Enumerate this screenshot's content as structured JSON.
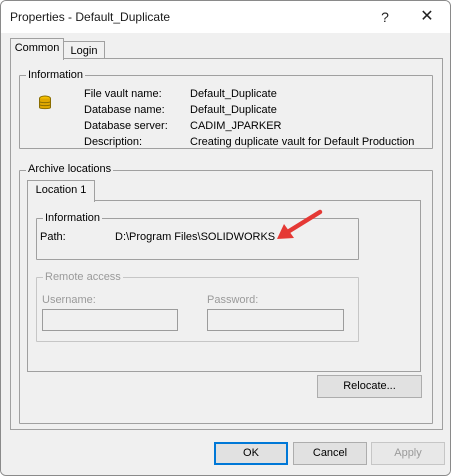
{
  "window": {
    "title": "Properties - Default_Duplicate",
    "help_glyph": "?",
    "close_glyph": "✕"
  },
  "tabs": [
    {
      "label": "Common",
      "active": true
    },
    {
      "label": "Login",
      "active": false
    }
  ],
  "information": {
    "group_label": "Information",
    "icon": "database-icon",
    "rows": [
      {
        "label": "File vault name:",
        "value": "Default_Duplicate"
      },
      {
        "label": "Database name:",
        "value": "Default_Duplicate"
      },
      {
        "label": "Database server:",
        "value": "CADIM_JPARKER"
      },
      {
        "label": "Description:",
        "value": "Creating duplicate vault for Default Production"
      }
    ]
  },
  "archive": {
    "group_label": "Archive locations",
    "tab_label": "Location 1",
    "info_group_label": "Information",
    "path_label": "Path:",
    "path_value": "D:\\Program Files\\SOLIDWORKS",
    "annotation_color": "#e53935",
    "remote": {
      "group_label": "Remote access",
      "username_label": "Username:",
      "username_value": "",
      "password_label": "Password:",
      "password_value": ""
    },
    "relocate_label": "Relocate..."
  },
  "buttons": {
    "ok": "OK",
    "cancel": "Cancel",
    "apply": "Apply"
  }
}
